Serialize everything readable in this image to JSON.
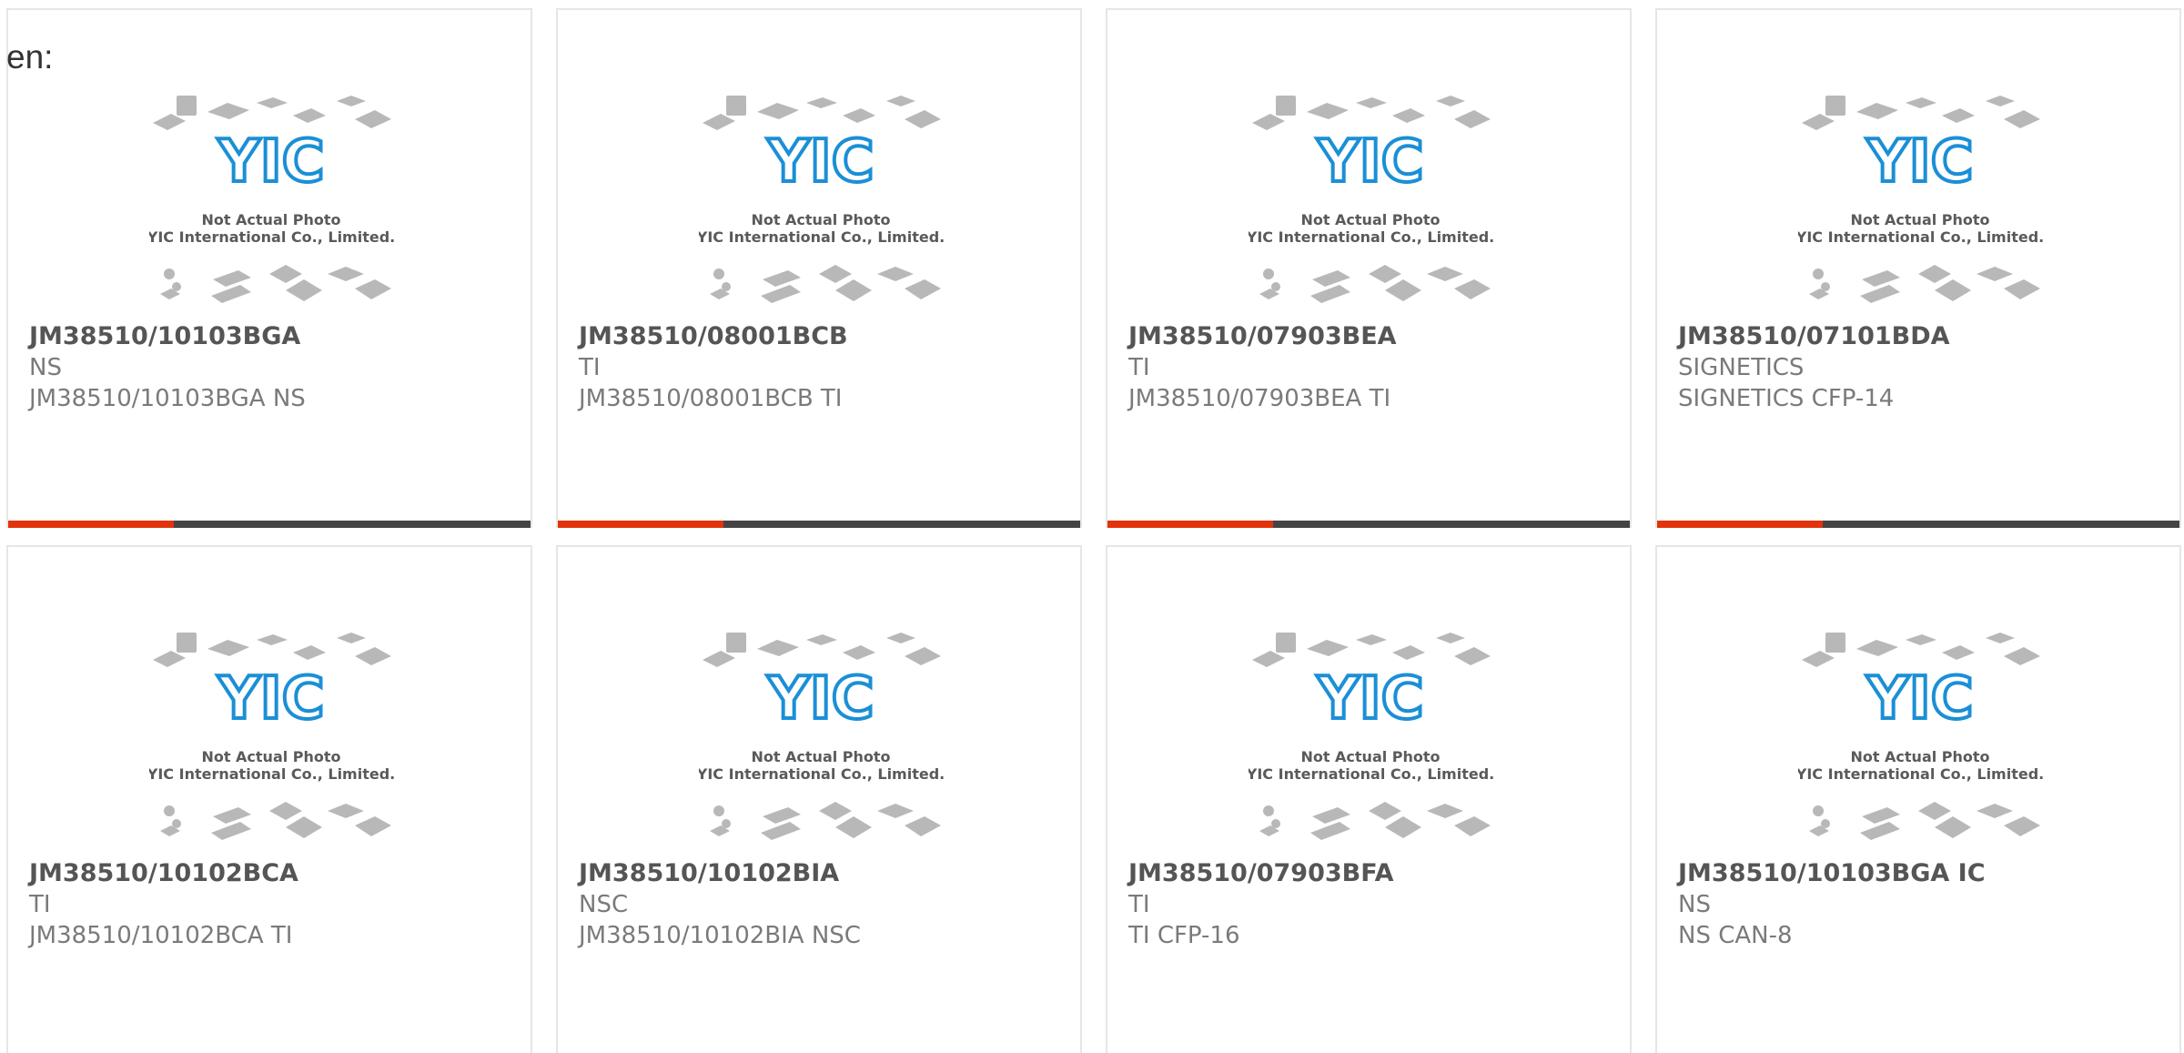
{
  "stray_label": "en:",
  "placeholder_image": {
    "icon": "yic-logo-icon",
    "line1": "Not Actual Photo",
    "line2": "YIC International Co., Limited.",
    "logo_text": "YIC"
  },
  "colors": {
    "accent": "#e2330d",
    "bar": "#444444",
    "border": "#e6e6e6",
    "logo": "#1b8fd6"
  },
  "products": [
    {
      "part": "JM38510/10103BGA",
      "manufacturer": "NS",
      "description": "JM38510/10103BGA NS"
    },
    {
      "part": "JM38510/08001BCB",
      "manufacturer": "TI",
      "description": "JM38510/08001BCB TI"
    },
    {
      "part": "JM38510/07903BEA",
      "manufacturer": "TI",
      "description": "JM38510/07903BEA TI"
    },
    {
      "part": "JM38510/07101BDA",
      "manufacturer": "SIGNETICS",
      "description": "SIGNETICS CFP-14"
    },
    {
      "part": "JM38510/10102BCA",
      "manufacturer": "TI",
      "description": "JM38510/10102BCA TI"
    },
    {
      "part": "JM38510/10102BIA",
      "manufacturer": "NSC",
      "description": "JM38510/10102BIA NSC"
    },
    {
      "part": "JM38510/07903BFA",
      "manufacturer": "TI",
      "description": "TI CFP-16"
    },
    {
      "part": "JM38510/10103BGA IC",
      "manufacturer": "NS",
      "description": "NS CAN-8"
    }
  ]
}
